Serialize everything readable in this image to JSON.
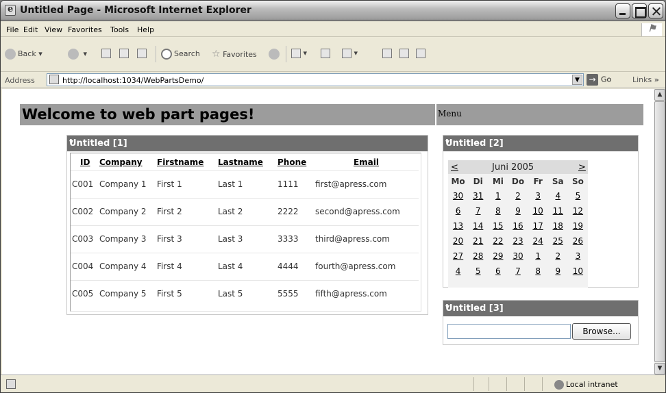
{
  "window": {
    "title": "Untitled Page - Microsoft Internet Explorer"
  },
  "menubar": {
    "file": "File",
    "edit": "Edit",
    "view": "View",
    "favorites": "Favorites",
    "tools": "Tools",
    "help": "Help"
  },
  "toolbar": {
    "back": "Back",
    "search": "Search",
    "favorites": "Favorites"
  },
  "address": {
    "label": "Address",
    "url": "http://localhost:1034/WebPartsDemo/",
    "go": "Go",
    "links": "Links"
  },
  "status": {
    "zone": "Local intranet"
  },
  "page": {
    "heading": "Welcome to web part pages!",
    "menu_zone": "Menu"
  },
  "webpart1": {
    "title": "Untitled [1]",
    "headers": [
      "ID",
      "Company",
      "Firstname",
      "Lastname",
      "Phone",
      "Email"
    ],
    "rows": [
      [
        "C001",
        "Company 1",
        "First 1",
        "Last 1",
        "1111",
        "first@apress.com"
      ],
      [
        "C002",
        "Company 2",
        "First 2",
        "Last 2",
        "2222",
        "second@apress.com"
      ],
      [
        "C003",
        "Company 3",
        "First 3",
        "Last 3",
        "3333",
        "third@apress.com"
      ],
      [
        "C004",
        "Company 4",
        "First 4",
        "Last 4",
        "4444",
        "fourth@apress.com"
      ],
      [
        "C005",
        "Company 5",
        "First 5",
        "Last 5",
        "5555",
        "fifth@apress.com"
      ]
    ]
  },
  "webpart2": {
    "title": "Untitled [2]",
    "prev": "<",
    "next": ">",
    "month": "Juni 2005",
    "days": [
      "Mo",
      "Di",
      "Mi",
      "Do",
      "Fr",
      "Sa",
      "So"
    ],
    "weeks": [
      [
        "30",
        "31",
        "1",
        "2",
        "3",
        "4",
        "5"
      ],
      [
        "6",
        "7",
        "8",
        "9",
        "10",
        "11",
        "12"
      ],
      [
        "13",
        "14",
        "15",
        "16",
        "17",
        "18",
        "19"
      ],
      [
        "20",
        "21",
        "22",
        "23",
        "24",
        "25",
        "26"
      ],
      [
        "27",
        "28",
        "29",
        "30",
        "1",
        "2",
        "3"
      ],
      [
        "4",
        "5",
        "6",
        "7",
        "8",
        "9",
        "10"
      ]
    ]
  },
  "webpart3": {
    "title": "Untitled [3]",
    "file_value": "",
    "browse": "Browse..."
  },
  "colors": {
    "part_title_bg": "#6f6f6f",
    "zone_bg": "#9c9c9c"
  }
}
